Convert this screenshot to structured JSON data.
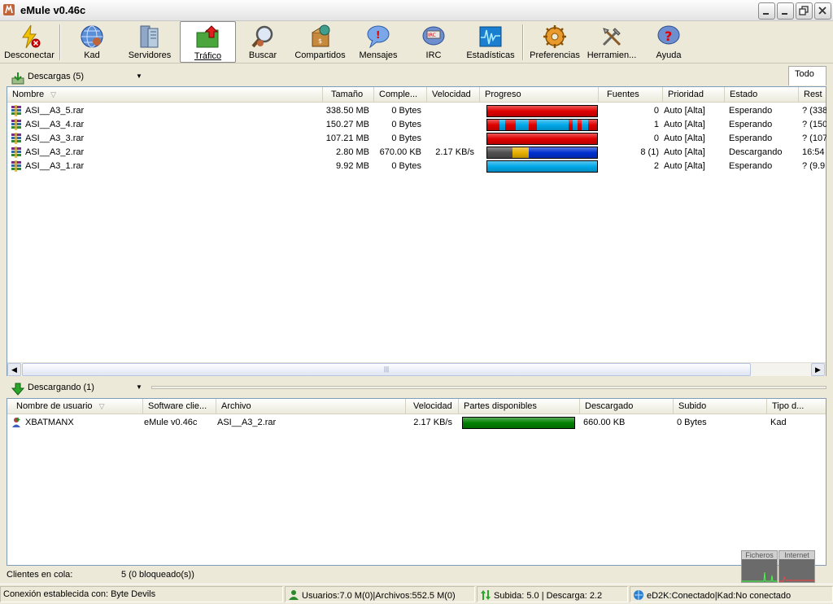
{
  "window": {
    "title": "eMule v0.46c",
    "controls": {
      "minimize": "_",
      "maximize": "□"
    }
  },
  "toolbar": {
    "items": [
      {
        "label": "Desconectar",
        "icon": "disconnect-icon"
      },
      {
        "label": "Kad",
        "icon": "kad-globe-icon"
      },
      {
        "label": "Servidores",
        "icon": "servers-icon"
      },
      {
        "label": "Tráfico",
        "icon": "transfer-folder-icon",
        "active": true
      },
      {
        "label": "Buscar",
        "icon": "search-icon"
      },
      {
        "label": "Compartidos",
        "icon": "shared-files-icon"
      },
      {
        "label": "Mensajes",
        "icon": "messages-icon"
      },
      {
        "label": "IRC",
        "icon": "irc-icon"
      },
      {
        "label": "Estadísticas",
        "icon": "statistics-icon"
      },
      {
        "label": "Preferencias",
        "icon": "preferences-icon"
      },
      {
        "label": "Herramien...",
        "icon": "tools-icon"
      },
      {
        "label": "Ayuda",
        "icon": "help-icon"
      }
    ]
  },
  "downloads": {
    "header": "Descargas (5)",
    "filter_tab": "Todo",
    "columns": [
      "Nombre",
      "Tamaño",
      "Comple...",
      "Velocidad",
      "Progreso",
      "Fuentes",
      "Prioridad",
      "Estado",
      "Rest"
    ],
    "rows": [
      {
        "name": "ASI__A3_5.rar",
        "size": "338.50 MB",
        "completed": "0 Bytes",
        "speed": "",
        "sources": "0",
        "priority": "Auto [Alta]",
        "status": "Esperando",
        "remaining": "? (338",
        "progress": [
          {
            "from": 0,
            "to": 1,
            "color": "#e00000"
          }
        ]
      },
      {
        "name": "ASI__A3_4.rar",
        "size": "150.27 MB",
        "completed": "0 Bytes",
        "speed": "",
        "sources": "1",
        "priority": "Auto [Alta]",
        "status": "Esperando",
        "remaining": "? (150",
        "progress": [
          {
            "from": 0,
            "to": 0.11,
            "color": "#e00000"
          },
          {
            "from": 0.11,
            "to": 0.16,
            "color": "#00a8e8"
          },
          {
            "from": 0.16,
            "to": 0.26,
            "color": "#e00000"
          },
          {
            "from": 0.26,
            "to": 0.38,
            "color": "#00a8e8"
          },
          {
            "from": 0.38,
            "to": 0.45,
            "color": "#e00000"
          },
          {
            "from": 0.45,
            "to": 0.74,
            "color": "#00a8e8"
          },
          {
            "from": 0.74,
            "to": 0.78,
            "color": "#e00000"
          },
          {
            "from": 0.78,
            "to": 0.82,
            "color": "#00a8e8"
          },
          {
            "from": 0.82,
            "to": 0.86,
            "color": "#e00000"
          },
          {
            "from": 0.86,
            "to": 0.92,
            "color": "#00a8e8"
          },
          {
            "from": 0.92,
            "to": 1,
            "color": "#e00000"
          }
        ]
      },
      {
        "name": "ASI__A3_3.rar",
        "size": "107.21 MB",
        "completed": "0 Bytes",
        "speed": "",
        "sources": "0",
        "priority": "Auto [Alta]",
        "status": "Esperando",
        "remaining": "? (107",
        "progress": [
          {
            "from": 0,
            "to": 1,
            "color": "#e00000"
          }
        ]
      },
      {
        "name": "ASI__A3_2.rar",
        "size": "2.80 MB",
        "completed": "670.00 KB",
        "speed": "2.17 KB/s",
        "sources": "8 (1)",
        "priority": "Auto [Alta]",
        "status": "Descargando",
        "remaining": "16:54",
        "progress": [
          {
            "from": 0,
            "to": 0.23,
            "color": "#505050"
          },
          {
            "from": 0.23,
            "to": 0.38,
            "color": "#e8b000"
          },
          {
            "from": 0.38,
            "to": 1,
            "color": "#0030d0"
          }
        ]
      },
      {
        "name": "ASI__A3_1.rar",
        "size": "9.92 MB",
        "completed": "0 Bytes",
        "speed": "",
        "sources": "2",
        "priority": "Auto [Alta]",
        "status": "Esperando",
        "remaining": "? (9.9",
        "progress": [
          {
            "from": 0,
            "to": 1,
            "color": "#00a8e8"
          }
        ]
      }
    ]
  },
  "active": {
    "header": "Descargando (1)",
    "columns": [
      "Nombre de usuario",
      "Software clie...",
      "Archivo",
      "Velocidad",
      "Partes disponibles",
      "Descargado",
      "Subido",
      "Tipo d..."
    ],
    "rows": [
      {
        "user": "XBATMANX",
        "software": "eMule v0.46c",
        "file": "ASI__A3_2.rar",
        "speed": "2.17 KB/s",
        "downloaded": "660.00 KB",
        "uploaded": "0 Bytes",
        "type": "Kad",
        "parts": [
          {
            "from": 0,
            "to": 1,
            "color": "#008000"
          }
        ]
      }
    ]
  },
  "queue": {
    "label": "Clientes en cola:",
    "value": "5 (0 bloqueado(s))"
  },
  "graphs": {
    "files_label": "Ficheros",
    "internet_label": "Internet"
  },
  "statusbar": {
    "connection": "Conexión establecida con: Byte Devils",
    "users": "Usuarios:7.0 M(0)|Archivos:552.5 M(0)",
    "rates": "Subida: 5.0 | Descarga: 2.2",
    "network": "eD2K:Conectado|Kad:No conectado"
  },
  "colors": {
    "accent_red": "#e00000",
    "accent_blue": "#00a8e8",
    "accent_green": "#008000"
  }
}
